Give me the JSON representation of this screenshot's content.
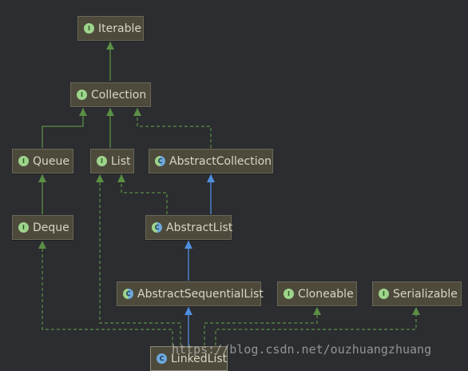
{
  "colors": {
    "background": "#2b2d30",
    "node_fill": "#4d4a3c",
    "node_text": "#d9d5c2",
    "interface_badge": "#9ed58c",
    "class_badge": "#6fa8dc",
    "interface_edge": "#5b8f45",
    "class_edge": "#4f8fe0"
  },
  "nodes": {
    "iterable": {
      "label": "Iterable",
      "badge": "I"
    },
    "collection": {
      "label": "Collection",
      "badge": "I"
    },
    "queue": {
      "label": "Queue",
      "badge": "I"
    },
    "list": {
      "label": "List",
      "badge": "I"
    },
    "abstract_collection": {
      "label": "AbstractCollection",
      "badge": "C"
    },
    "deque": {
      "label": "Deque",
      "badge": "I"
    },
    "abstract_list": {
      "label": "AbstractList",
      "badge": "C"
    },
    "abstract_sequential_list": {
      "label": "AbstractSequentialList",
      "badge": "C"
    },
    "cloneable": {
      "label": "Cloneable",
      "badge": "I"
    },
    "serializable": {
      "label": "Serializable",
      "badge": "I"
    },
    "linked_list": {
      "label": "LinkedList",
      "badge": "C"
    }
  },
  "watermark": "https://blog.csdn.net/ouzhuangzhuang"
}
